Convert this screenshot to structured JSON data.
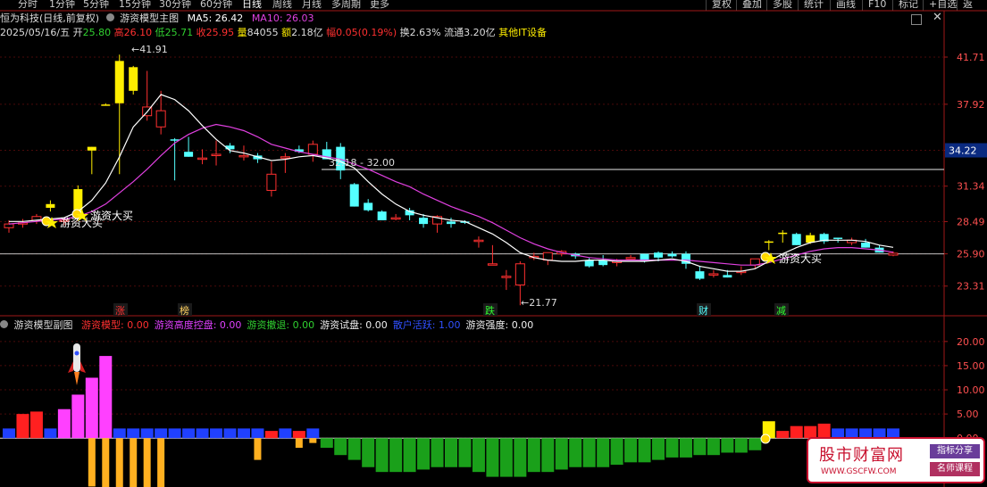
{
  "toolbar": {
    "periods": [
      "分时",
      "1分钟",
      "5分钟",
      "15分钟",
      "30分钟",
      "60分钟",
      "日线",
      "周线",
      "月线",
      "多周期",
      "更多"
    ],
    "active_period": "日线",
    "right_buttons": [
      "复权",
      "叠加",
      "多股",
      "统计",
      "画线",
      "F10",
      "标记",
      "+自选",
      "返回"
    ]
  },
  "main": {
    "title": "恒为科技(日线,前复权)",
    "indicator_name": "游资模型主图",
    "ma5_label": "MA5: 26.42",
    "ma10_label": "MA10: 26.03",
    "info": {
      "date": "2025/05/16/五",
      "open_label": "开",
      "open": "25.80",
      "high_label": "高",
      "high": "26.10",
      "low_label": "低",
      "low": "25.71",
      "close_label": "收",
      "close": "25.95",
      "volume_label": "量",
      "volume": "84055",
      "amount_label": "额",
      "amount": "2.18亿",
      "change_label": "幅",
      "change": "0.05(0.19%)",
      "turnover_label": "换",
      "turnover": "2.63%",
      "float_label": "流通",
      "float_cap": "3.20亿",
      "sector": "其他IT设备"
    },
    "price_axis": [
      "41.71",
      "37.92",
      "34.22",
      "31.34",
      "28.49",
      "25.90",
      "23.31"
    ],
    "current_price": "34.22",
    "annotations": {
      "high": "41.91",
      "low": "21.77",
      "range": "32.18 - 32.00",
      "buy1": "游资大买",
      "buy2": "游资大买",
      "buy3": "游资大买"
    },
    "markers": [
      "涨",
      "榜",
      "跌",
      "财",
      "减"
    ]
  },
  "sub": {
    "title": "游资模型副图",
    "legend": [
      {
        "label": "游资模型: 0.00",
        "color": "#ff3030"
      },
      {
        "label": "游资高度控盘: 0.00",
        "color": "#e040ff"
      },
      {
        "label": "游资撤退: 0.00",
        "color": "#30d030"
      },
      {
        "label": "游资试盘: 0.00",
        "color": "#f0f0f0"
      },
      {
        "label": "散户活跃: 1.00",
        "color": "#3050ff"
      },
      {
        "label": "游资强度: 0.00",
        "color": "#f0f0f0"
      }
    ],
    "axis": [
      "20.00",
      "15.00",
      "10.00",
      "5.00",
      "0.00"
    ]
  },
  "watermark": {
    "title": "股市财富网",
    "url": "WWW.GSCFW.COM",
    "badge1": "指标分享",
    "badge2": "名师课程"
  },
  "colors": {
    "up": "#ff3030",
    "down": "#54ffff",
    "yellow": "#ffee00",
    "ma5": "#ffffff",
    "ma10": "#e040e0"
  },
  "chart_data": {
    "type": "candlestick",
    "ohlc": [
      [
        28.0,
        28.6,
        27.6,
        28.3
      ],
      [
        28.3,
        28.7,
        28.0,
        28.4
      ],
      [
        28.6,
        29.1,
        28.3,
        28.9
      ],
      [
        29.6,
        30.2,
        29.3,
        29.9
      ],
      [
        28.5,
        28.8,
        28.2,
        28.6
      ],
      [
        29.2,
        31.4,
        28.9,
        31.1
      ],
      [
        34.2,
        34.5,
        32.3,
        34.5
      ],
      [
        37.9,
        38.0,
        37.8,
        37.9
      ],
      [
        38.0,
        41.91,
        32.3,
        41.4
      ],
      [
        40.9,
        41.0,
        38.7,
        39.0
      ],
      [
        37.0,
        40.6,
        36.6,
        37.7
      ],
      [
        36.1,
        39.0,
        35.5,
        37.4
      ],
      [
        35.1,
        35.2,
        31.8,
        35.0
      ],
      [
        34.1,
        35.3,
        33.7,
        33.7
      ],
      [
        33.6,
        34.3,
        33.1,
        33.6
      ],
      [
        33.9,
        35.0,
        33.0,
        33.9
      ],
      [
        34.6,
        34.8,
        34.0,
        34.3
      ],
      [
        33.7,
        34.6,
        33.4,
        33.8
      ],
      [
        33.8,
        34.0,
        33.2,
        33.5
      ],
      [
        31.0,
        33.3,
        30.5,
        32.3
      ],
      [
        33.6,
        34.0,
        32.4,
        33.7
      ],
      [
        34.3,
        34.6,
        34.0,
        34.1
      ],
      [
        33.9,
        35.0,
        33.3,
        34.7
      ],
      [
        34.3,
        34.9,
        33.8,
        33.5
      ],
      [
        34.5,
        34.8,
        31.9,
        32.6
      ],
      [
        31.5,
        31.6,
        29.7,
        29.7
      ],
      [
        30.0,
        30.3,
        29.3,
        29.4
      ],
      [
        29.3,
        29.4,
        28.7,
        28.6
      ],
      [
        28.7,
        29.1,
        28.6,
        28.8
      ],
      [
        29.4,
        29.6,
        28.6,
        29.0
      ],
      [
        28.8,
        29.1,
        28.0,
        28.3
      ],
      [
        28.3,
        29.0,
        27.6,
        28.9
      ],
      [
        28.5,
        28.8,
        28.0,
        28.3
      ],
      [
        28.5,
        28.6,
        28.3,
        28.4
      ],
      [
        27.0,
        27.3,
        26.4,
        27.0
      ],
      [
        25.1,
        26.6,
        25.0,
        25.1
      ],
      [
        24.1,
        24.6,
        23.0,
        24.1
      ],
      [
        23.4,
        25.3,
        21.77,
        25.1
      ],
      [
        25.7,
        26.0,
        25.4,
        25.7
      ],
      [
        25.4,
        26.0,
        25.0,
        26.0
      ],
      [
        25.9,
        26.2,
        25.7,
        26.1
      ],
      [
        25.9,
        26.0,
        25.5,
        25.7
      ],
      [
        25.4,
        25.6,
        24.8,
        24.9
      ],
      [
        25.4,
        25.8,
        24.9,
        25.0
      ],
      [
        25.2,
        25.5,
        24.9,
        25.3
      ],
      [
        25.6,
        25.8,
        25.5,
        25.6
      ],
      [
        25.9,
        25.9,
        25.2,
        25.3
      ],
      [
        26.0,
        26.1,
        25.3,
        25.6
      ],
      [
        25.9,
        26.1,
        25.6,
        25.7
      ],
      [
        25.9,
        26.1,
        24.7,
        25.1
      ],
      [
        24.5,
        24.9,
        23.8,
        23.9
      ],
      [
        24.3,
        24.6,
        24.0,
        24.3
      ],
      [
        24.2,
        24.6,
        24.0,
        24.0
      ],
      [
        24.4,
        24.9,
        24.2,
        24.5
      ],
      [
        25.0,
        25.4,
        24.7,
        25.5
      ],
      [
        26.9,
        27.0,
        26.2,
        26.8
      ],
      [
        27.6,
        27.8,
        26.8,
        27.6
      ],
      [
        27.5,
        27.6,
        26.6,
        26.6
      ],
      [
        27.4,
        27.6,
        26.7,
        26.8
      ],
      [
        27.5,
        27.6,
        26.7,
        26.9
      ],
      [
        27.2,
        27.2,
        26.8,
        27.1
      ],
      [
        26.8,
        27.2,
        26.6,
        27.0
      ],
      [
        26.8,
        27.1,
        26.4,
        26.4
      ],
      [
        26.4,
        26.6,
        26.0,
        26.0
      ],
      [
        25.8,
        26.1,
        25.71,
        25.95
      ]
    ],
    "ma5": [
      28.5,
      28.5,
      28.6,
      28.7,
      28.8,
      29.3,
      30.2,
      31.6,
      33.7,
      36.1,
      37.3,
      38.7,
      38.3,
      37.4,
      36.2,
      35.1,
      34.2,
      34.0,
      33.7,
      33.4,
      33.5,
      33.7,
      33.8,
      33.6,
      33.3,
      32.8,
      31.7,
      30.7,
      29.9,
      29.3,
      29.0,
      28.8,
      28.6,
      28.5,
      28.0,
      27.5,
      26.8,
      26.0,
      25.6,
      25.4,
      25.3,
      25.3,
      25.4,
      25.4,
      25.3,
      25.3,
      25.3,
      25.4,
      25.5,
      25.3,
      24.9,
      24.7,
      24.5,
      24.5,
      24.7,
      25.3,
      25.9,
      26.4,
      26.8,
      27.0,
      27.0,
      27.0,
      26.9,
      26.6,
      26.42
    ],
    "ma10": [
      28.3,
      28.4,
      28.5,
      28.6,
      28.7,
      28.9,
      29.3,
      29.9,
      30.8,
      31.7,
      32.7,
      33.8,
      34.8,
      35.5,
      36.0,
      36.3,
      36.1,
      35.8,
      35.3,
      34.7,
      34.4,
      34.1,
      33.9,
      33.7,
      33.5,
      33.1,
      32.7,
      32.2,
      31.7,
      31.3,
      30.7,
      30.2,
      29.7,
      29.3,
      28.9,
      28.4,
      27.8,
      27.2,
      26.7,
      26.3,
      26.0,
      25.8,
      25.6,
      25.5,
      25.4,
      25.4,
      25.4,
      25.4,
      25.4,
      25.4,
      25.3,
      25.2,
      25.1,
      25.0,
      25.0,
      25.2,
      25.5,
      25.8,
      26.1,
      26.3,
      26.4,
      26.4,
      26.3,
      26.2,
      26.03
    ],
    "sub_values": [
      2,
      5,
      5.5,
      2,
      6,
      9,
      12.5,
      17,
      2,
      2,
      2,
      2,
      2,
      2,
      2,
      2,
      2,
      2,
      2,
      1.5,
      2,
      1.5,
      2,
      -2,
      -3.5,
      -4.5,
      -6,
      -7,
      -7,
      -7,
      -6.5,
      -6,
      -6,
      -6,
      -7,
      -8,
      -8,
      -8,
      -7,
      -7,
      -6.5,
      -6,
      -6,
      -6,
      -5.5,
      -5,
      -5,
      -4.5,
      -4,
      -4,
      -3.5,
      -3.5,
      -3,
      -3,
      -2.5,
      3.5,
      1.5,
      2.5,
      2.5,
      3,
      2,
      2,
      2,
      2,
      2
    ],
    "sub_neg_gold": [
      [
        6,
        -10
      ],
      [
        7,
        -11
      ],
      [
        8,
        -13
      ],
      [
        9,
        -14
      ],
      [
        10,
        -13
      ],
      [
        11,
        -14
      ],
      [
        18,
        -4.5
      ],
      [
        21,
        -2
      ],
      [
        22,
        -1
      ]
    ],
    "ylim_main": [
      21.5,
      43.0
    ],
    "ylim_sub": [
      -9,
      22
    ]
  }
}
